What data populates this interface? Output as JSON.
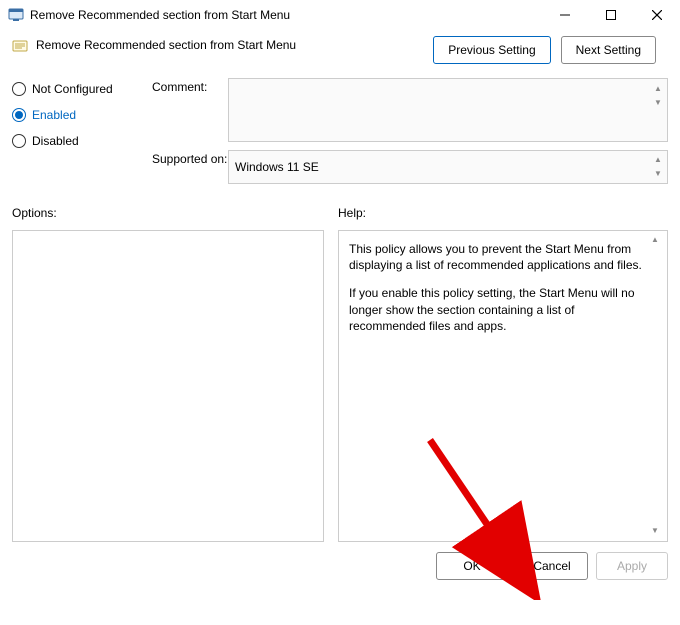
{
  "window": {
    "title": "Remove Recommended section from Start Menu"
  },
  "subtitle": "Remove Recommended section from Start Menu",
  "nav": {
    "previous": "Previous Setting",
    "next": "Next Setting"
  },
  "radios": {
    "not_configured": "Not Configured",
    "enabled": "Enabled",
    "disabled": "Disabled",
    "selected": "enabled"
  },
  "fields": {
    "comment_label": "Comment:",
    "comment_value": "",
    "supported_label": "Supported on:",
    "supported_value": "Windows 11 SE"
  },
  "lower": {
    "options_label": "Options:",
    "help_label": "Help:",
    "help_p1": "This policy allows you to prevent the Start Menu from displaying a list of recommended applications and files.",
    "help_p2": "If you enable this policy setting, the Start Menu will no longer show the section containing a list of recommended files and apps."
  },
  "footer": {
    "ok": "OK",
    "cancel": "Cancel",
    "apply": "Apply"
  }
}
